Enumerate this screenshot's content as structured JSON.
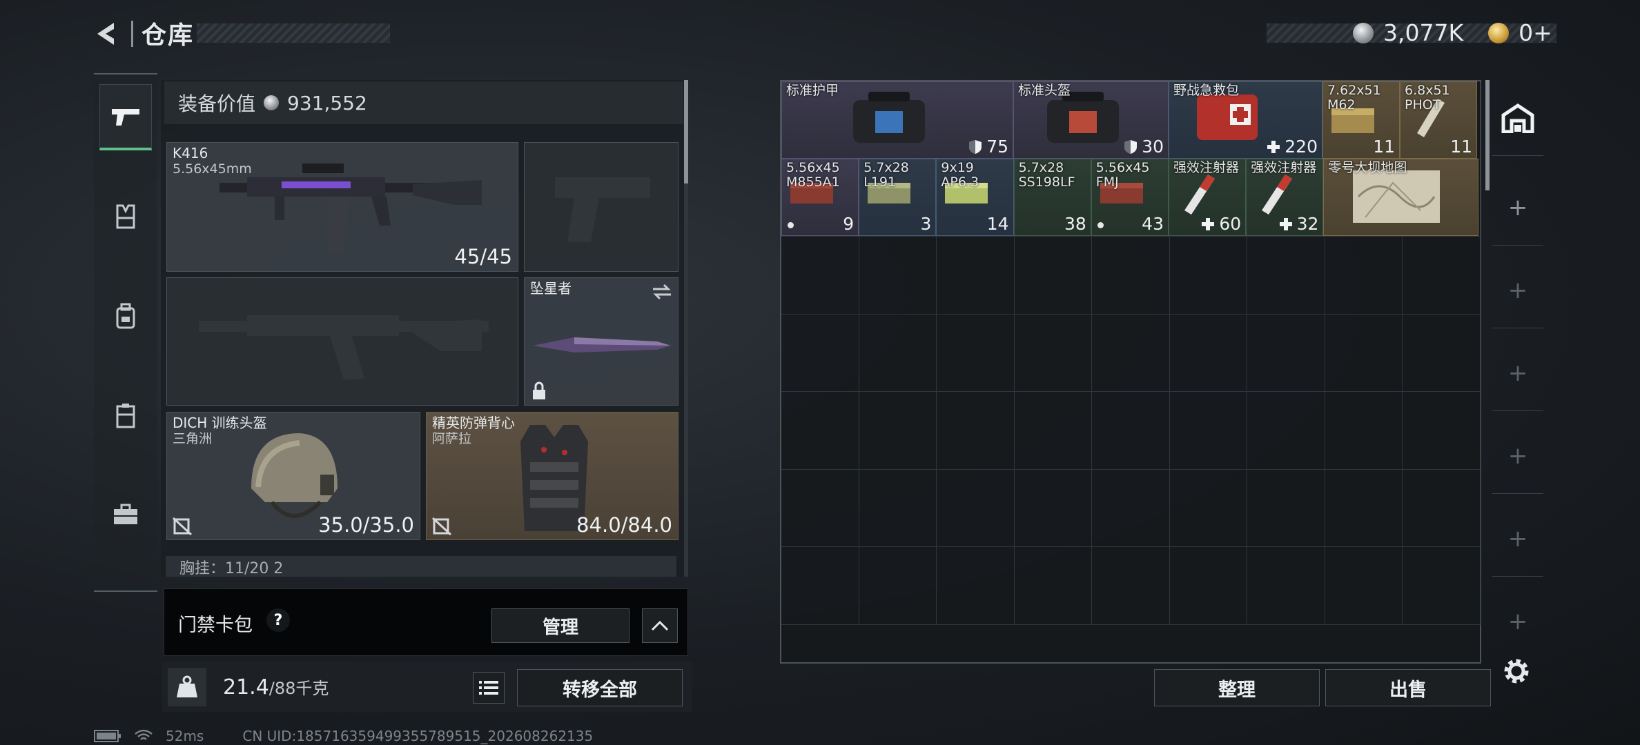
{
  "header": {
    "title": "仓库",
    "currency_silver": "3,077K",
    "currency_gold": "0+"
  },
  "loadout": {
    "value_label": "装备价值",
    "value": "931,552",
    "primary": {
      "name": "K416",
      "caliber": "5.56x45mm",
      "ammo": "45/45"
    },
    "melee": {
      "name": "坠星者"
    },
    "helmet": {
      "name": "DICH 训练头盔",
      "sub": "三角洲",
      "durability": "35.0/35.0"
    },
    "armor": {
      "name": "精英防弹背心",
      "sub": "阿萨拉",
      "durability": "84.0/84.0"
    },
    "chest_rig": "胸挂：11/20  2"
  },
  "keycard": {
    "label": "门禁卡包",
    "help": "?",
    "manage_label": "管理"
  },
  "weight": {
    "value": "21.4",
    "max": "/88千克",
    "transfer_label": "转移全部"
  },
  "warehouse": {
    "items": [
      {
        "name": "标准护甲",
        "count": "75",
        "icon": "shield-icon",
        "tier": "purple"
      },
      {
        "name": "标准头盔",
        "count": "30",
        "icon": "shield-icon",
        "tier": "purple"
      },
      {
        "name": "野战急救包",
        "count": "220",
        "icon": "plus-icon",
        "tier": "blue"
      },
      {
        "name": "7.62x51\nM62",
        "count": "11",
        "tier": "gold"
      },
      {
        "name": "6.8x51\nPHOT",
        "count": "11",
        "tier": "gold"
      },
      {
        "name": "5.56x45\nM855A1",
        "count": "9",
        "dot": true,
        "tier": "purple"
      },
      {
        "name": "5.7x28\nL191",
        "count": "3",
        "tier": "blue"
      },
      {
        "name": "9x19\nAP6.3",
        "count": "14",
        "tier": "blue"
      },
      {
        "name": "5.7x28\nSS198LF",
        "count": "38",
        "tier": "green"
      },
      {
        "name": "5.56x45\nFMJ",
        "count": "43",
        "dot": true,
        "tier": "green"
      },
      {
        "name": "强效注射器",
        "count": "60",
        "icon": "plus-icon",
        "tier": "green"
      },
      {
        "name": "强效注射器",
        "count": "32",
        "icon": "plus-icon",
        "tier": "green"
      },
      {
        "name": "零号大坝地图",
        "count": "",
        "tier": "gold"
      }
    ],
    "sort_label": "整理",
    "sell_label": "出售"
  },
  "status": {
    "ping": "52ms",
    "uid": "CN UID:185716359499355789515_202608262135"
  }
}
